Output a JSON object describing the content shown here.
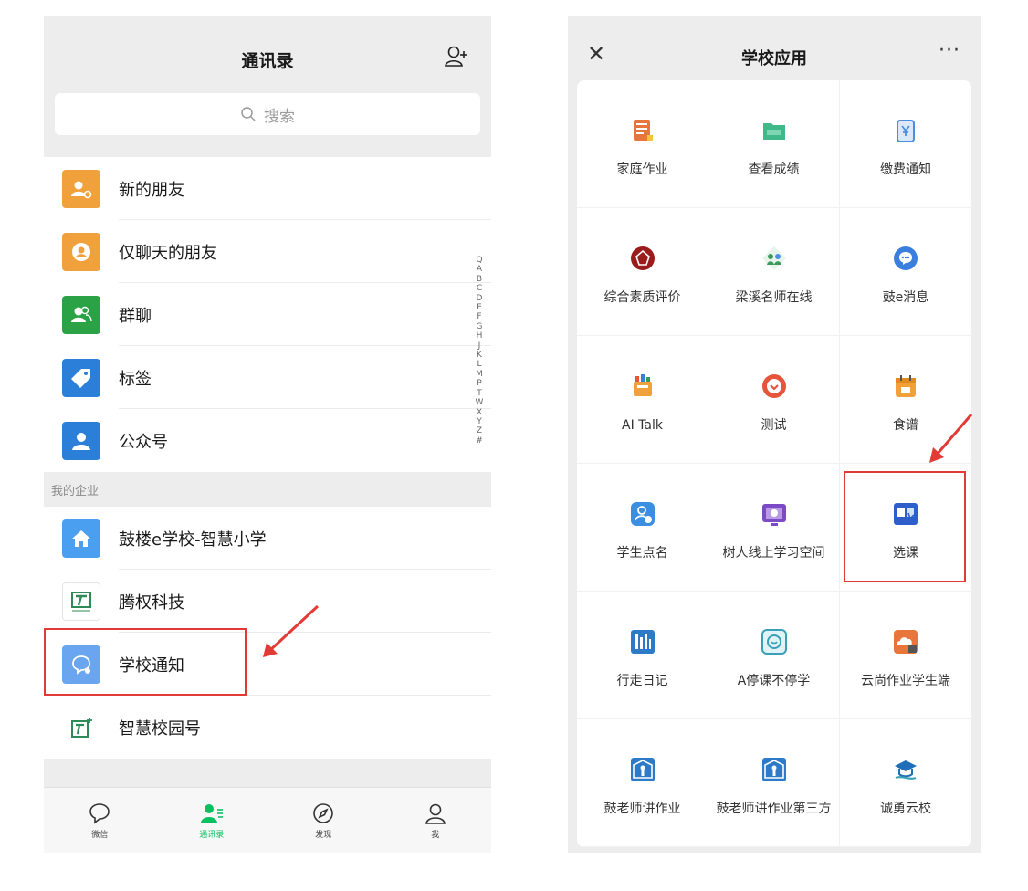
{
  "contacts": {
    "title": "通讯录",
    "search_placeholder": "搜索",
    "items": [
      {
        "label": "新的朋友",
        "icon": "new-friend-icon",
        "color": "#f0a13c"
      },
      {
        "label": "仅聊天的朋友",
        "icon": "chat-only-friend-icon",
        "color": "#f0a13c"
      },
      {
        "label": "群聊",
        "icon": "group-chat-icon",
        "color": "#2ba245"
      },
      {
        "label": "标签",
        "icon": "tag-icon",
        "color": "#2b7fd9"
      },
      {
        "label": "公众号",
        "icon": "official-account-icon",
        "color": "#2b7fd9"
      }
    ],
    "section_label": "我的企业",
    "enterprise_items": [
      {
        "label": "鼓楼e学校-智慧小学",
        "icon": "home-icon",
        "color": "#4a9ff0"
      },
      {
        "label": "腾权科技",
        "icon": "tengquan-logo-icon",
        "color": "#2e8b57"
      },
      {
        "label": "学校通知",
        "icon": "school-notice-icon",
        "color": "#6aa6f0"
      },
      {
        "label": "智慧校园号",
        "icon": "smart-campus-icon",
        "color": "#2e8b57"
      }
    ],
    "alpha_index": [
      "Q",
      "A",
      "B",
      "C",
      "D",
      "E",
      "F",
      "G",
      "H",
      "J",
      "K",
      "L",
      "M",
      "P",
      "T",
      "W",
      "X",
      "Y",
      "Z",
      "#"
    ],
    "tabs": [
      {
        "label": "微信",
        "icon": "chat-bubble-icon"
      },
      {
        "label": "通讯录",
        "icon": "contacts-icon",
        "active": true
      },
      {
        "label": "发现",
        "icon": "compass-icon"
      },
      {
        "label": "我",
        "icon": "me-icon"
      }
    ]
  },
  "school_apps": {
    "title": "学校应用",
    "close_glyph": "✕",
    "more_glyph": "···",
    "apps": [
      {
        "label": "家庭作业",
        "icon": "homework-icon",
        "color": "#e8763a"
      },
      {
        "label": "查看成绩",
        "icon": "grades-icon",
        "color": "#3fb98a"
      },
      {
        "label": "缴费通知",
        "icon": "payment-icon",
        "color": "#4a8fe0"
      },
      {
        "label": "综合素质评价",
        "icon": "quality-eval-icon",
        "color": "#9b1c1c"
      },
      {
        "label": "梁溪名师在线",
        "icon": "teacher-online-icon",
        "color": "#3a9a5b"
      },
      {
        "label": "鼓e消息",
        "icon": "message-icon",
        "color": "#3a7ee0"
      },
      {
        "label": "AI Talk",
        "icon": "ai-talk-icon",
        "color": "#f0a13c"
      },
      {
        "label": "测试",
        "icon": "test-icon",
        "color": "#e4553b"
      },
      {
        "label": "食谱",
        "icon": "recipe-icon",
        "color": "#f0a13c"
      },
      {
        "label": "学生点名",
        "icon": "roll-call-icon",
        "color": "#3a8fe0"
      },
      {
        "label": "树人线上学习空间",
        "icon": "online-study-icon",
        "color": "#7b4ac4"
      },
      {
        "label": "选课",
        "icon": "course-select-icon",
        "color": "#2d5ec9"
      },
      {
        "label": "行走日记",
        "icon": "diary-icon",
        "color": "#2d7ac9"
      },
      {
        "label": "A停课不停学",
        "icon": "keep-learning-icon",
        "color": "#3aa0b8"
      },
      {
        "label": "云尚作业学生端",
        "icon": "cloud-homework-icon",
        "color": "#e8763a"
      },
      {
        "label": "鼓老师讲作业",
        "icon": "teacher-explain-icon",
        "color": "#2d7ac9"
      },
      {
        "label": "鼓老师讲作业第三方",
        "icon": "teacher-explain-3rd-icon",
        "color": "#2d7ac9"
      },
      {
        "label": "诚勇云校",
        "icon": "cloud-school-icon",
        "color": "#1f6fb8"
      }
    ]
  },
  "annotations": {
    "highlight_color": "#e23a34"
  }
}
